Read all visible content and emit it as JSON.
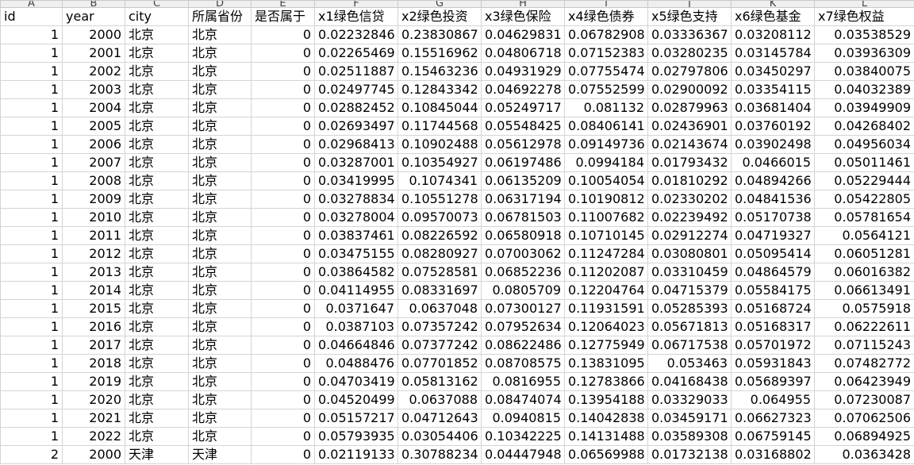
{
  "columns": [
    "A",
    "B",
    "C",
    "D",
    "E",
    "F",
    "G",
    "H",
    "I",
    "J",
    "K",
    "L"
  ],
  "headers": [
    "id",
    "year",
    "city",
    "所属省份",
    "是否属于",
    "x1绿色信贷",
    "x2绿色投资",
    "x3绿色保险",
    "x4绿色债券",
    "x5绿色支持",
    "x6绿色基金",
    "x7绿色权益"
  ],
  "rows": [
    [
      "1",
      "2000",
      "北京",
      "北京",
      "0",
      "0.02232846",
      "0.23830867",
      "0.04629831",
      "0.06782908",
      "0.03336367",
      "0.03208112",
      "0.03538529"
    ],
    [
      "1",
      "2001",
      "北京",
      "北京",
      "0",
      "0.02265469",
      "0.15516962",
      "0.04806718",
      "0.07152383",
      "0.03280235",
      "0.03145784",
      "0.03936309"
    ],
    [
      "1",
      "2002",
      "北京",
      "北京",
      "0",
      "0.02511887",
      "0.15463236",
      "0.04931929",
      "0.07755474",
      "0.02797806",
      "0.03450297",
      "0.03840075"
    ],
    [
      "1",
      "2003",
      "北京",
      "北京",
      "0",
      "0.02497745",
      "0.12843342",
      "0.04692278",
      "0.07552599",
      "0.02900092",
      "0.03354115",
      "0.04032389"
    ],
    [
      "1",
      "2004",
      "北京",
      "北京",
      "0",
      "0.02882452",
      "0.10845044",
      "0.05249717",
      "0.081132",
      "0.02879963",
      "0.03681404",
      "0.03949909"
    ],
    [
      "1",
      "2005",
      "北京",
      "北京",
      "0",
      "0.02693497",
      "0.11744568",
      "0.05548425",
      "0.08406141",
      "0.02436901",
      "0.03760192",
      "0.04268402"
    ],
    [
      "1",
      "2006",
      "北京",
      "北京",
      "0",
      "0.02968413",
      "0.10902488",
      "0.05612978",
      "0.09149736",
      "0.02143674",
      "0.03902498",
      "0.04956034"
    ],
    [
      "1",
      "2007",
      "北京",
      "北京",
      "0",
      "0.03287001",
      "0.10354927",
      "0.06197486",
      "0.0994184",
      "0.01793432",
      "0.0466015",
      "0.05011461"
    ],
    [
      "1",
      "2008",
      "北京",
      "北京",
      "0",
      "0.03419995",
      "0.1074341",
      "0.06135209",
      "0.10054054",
      "0.01810292",
      "0.04894266",
      "0.05229444"
    ],
    [
      "1",
      "2009",
      "北京",
      "北京",
      "0",
      "0.03278834",
      "0.10551278",
      "0.06317194",
      "0.10190812",
      "0.02330202",
      "0.04841536",
      "0.05422805"
    ],
    [
      "1",
      "2010",
      "北京",
      "北京",
      "0",
      "0.03278004",
      "0.09570073",
      "0.06781503",
      "0.11007682",
      "0.02239492",
      "0.05170738",
      "0.05781654"
    ],
    [
      "1",
      "2011",
      "北京",
      "北京",
      "0",
      "0.03837461",
      "0.08226592",
      "0.06580918",
      "0.10710145",
      "0.02912274",
      "0.04719327",
      "0.0564121"
    ],
    [
      "1",
      "2012",
      "北京",
      "北京",
      "0",
      "0.03475155",
      "0.08280927",
      "0.07003062",
      "0.11247284",
      "0.03080801",
      "0.05095414",
      "0.06051281"
    ],
    [
      "1",
      "2013",
      "北京",
      "北京",
      "0",
      "0.03864582",
      "0.07528581",
      "0.06852236",
      "0.11202087",
      "0.03310459",
      "0.04864579",
      "0.06016382"
    ],
    [
      "1",
      "2014",
      "北京",
      "北京",
      "0",
      "0.04114955",
      "0.08331697",
      "0.0805709",
      "0.12204764",
      "0.04715379",
      "0.05584175",
      "0.06613491"
    ],
    [
      "1",
      "2015",
      "北京",
      "北京",
      "0",
      "0.0371647",
      "0.0637048",
      "0.07300127",
      "0.11931591",
      "0.05285393",
      "0.05168724",
      "0.0575918"
    ],
    [
      "1",
      "2016",
      "北京",
      "北京",
      "0",
      "0.0387103",
      "0.07357242",
      "0.07952634",
      "0.12064023",
      "0.05671813",
      "0.05168317",
      "0.06222611"
    ],
    [
      "1",
      "2017",
      "北京",
      "北京",
      "0",
      "0.04664846",
      "0.07377242",
      "0.08622486",
      "0.12775949",
      "0.06717538",
      "0.05701972",
      "0.07115243"
    ],
    [
      "1",
      "2018",
      "北京",
      "北京",
      "0",
      "0.0488476",
      "0.07701852",
      "0.08708575",
      "0.13831095",
      "0.053463",
      "0.05931843",
      "0.07482772"
    ],
    [
      "1",
      "2019",
      "北京",
      "北京",
      "0",
      "0.04703419",
      "0.05813162",
      "0.0816955",
      "0.12783866",
      "0.04168438",
      "0.05689397",
      "0.06423949"
    ],
    [
      "1",
      "2020",
      "北京",
      "北京",
      "0",
      "0.04520499",
      "0.0637088",
      "0.08474074",
      "0.13954188",
      "0.03329033",
      "0.064955",
      "0.07230087"
    ],
    [
      "1",
      "2021",
      "北京",
      "北京",
      "0",
      "0.05157217",
      "0.04712643",
      "0.0940815",
      "0.14042838",
      "0.03459171",
      "0.06627323",
      "0.07062506"
    ],
    [
      "1",
      "2022",
      "北京",
      "北京",
      "0",
      "0.05793935",
      "0.03054406",
      "0.10342225",
      "0.14131488",
      "0.03589308",
      "0.06759145",
      "0.06894925"
    ],
    [
      "2",
      "2000",
      "天津",
      "天津",
      "0",
      "0.02119133",
      "0.30788234",
      "0.04447948",
      "0.06569988",
      "0.01732138",
      "0.03168802",
      "0.0363428"
    ]
  ]
}
